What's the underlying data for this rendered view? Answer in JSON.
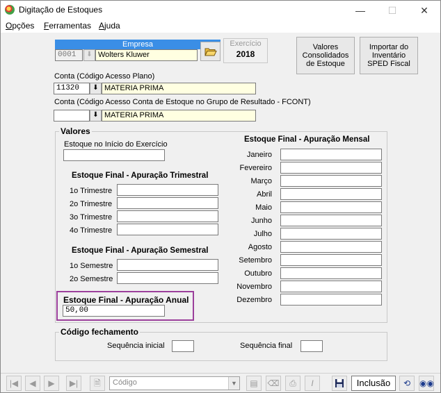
{
  "window": {
    "title": "Digitação de Estoques"
  },
  "menu": [
    {
      "hot": "O",
      "rest": "pções"
    },
    {
      "hot": "F",
      "rest": "erramentas"
    },
    {
      "hot": "A",
      "rest": "juda"
    }
  ],
  "empresa": {
    "header": "Empresa",
    "code": "0001",
    "name": "Wolters Kluwer"
  },
  "exercicio": {
    "label": "Exercício",
    "value": "2018"
  },
  "buttons": {
    "valores": [
      "Valores",
      "Consolidados",
      "de Estoque"
    ],
    "importar": [
      "Importar do",
      "Inventário",
      "SPED Fiscal"
    ]
  },
  "conta": {
    "label": "Conta (Código Acesso Plano)",
    "code": "11320",
    "desc": "MATERIA PRIMA"
  },
  "conta_fcont": {
    "label": "Conta (Código Acesso Conta de Estoque no Grupo de Resultado - FCONT)",
    "code": "",
    "desc": "MATERIA PRIMA"
  },
  "valores": {
    "legend": "Valores",
    "inicio_label": "Estoque no Início do Exercício",
    "inicio_value": "",
    "trimestral_title": "Estoque Final - Apuração Trimestral",
    "trimestres": [
      {
        "label": "1o Trimestre",
        "value": ""
      },
      {
        "label": "2o Trimestre",
        "value": ""
      },
      {
        "label": "3o Trimestre",
        "value": ""
      },
      {
        "label": "4o Trimestre",
        "value": ""
      }
    ],
    "semestral_title": "Estoque Final - Apuração Semestral",
    "semestres": [
      {
        "label": "1o Semestre",
        "value": ""
      },
      {
        "label": "2o Semestre",
        "value": ""
      }
    ],
    "anual_title": "Estoque Final - Apuração Anual",
    "anual_value": "50,00",
    "mensal_title": "Estoque Final - Apuração Mensal",
    "meses": [
      {
        "label": "Janeiro",
        "value": ""
      },
      {
        "label": "Fevereiro",
        "value": ""
      },
      {
        "label": "Março",
        "value": ""
      },
      {
        "label": "Abril",
        "value": ""
      },
      {
        "label": "Maio",
        "value": ""
      },
      {
        "label": "Junho",
        "value": ""
      },
      {
        "label": "Julho",
        "value": ""
      },
      {
        "label": "Agosto",
        "value": ""
      },
      {
        "label": "Setembro",
        "value": ""
      },
      {
        "label": "Outubro",
        "value": ""
      },
      {
        "label": "Novembro",
        "value": ""
      },
      {
        "label": "Dezembro",
        "value": ""
      }
    ]
  },
  "fechamento": {
    "legend": "Código fechamento",
    "seq_inicial_label": "Sequência inicial",
    "seq_inicial_value": "",
    "seq_final_label": "Sequência final",
    "seq_final_value": ""
  },
  "toolbar": {
    "combo_value": "Código",
    "status": "Inclusão"
  },
  "colors": {
    "accent": "#3a8ee6",
    "highlight_border": "#9b3f9b",
    "field_yellow": "#ffffe1"
  },
  "icons": [
    "app-icon",
    "minimize-icon",
    "maximize-icon",
    "close-icon",
    "open-folder-icon",
    "first-record-icon",
    "previous-record-icon",
    "next-record-icon",
    "last-record-icon",
    "new-document-icon",
    "save-disk-icon",
    "undo-icon",
    "binoculars-icon"
  ]
}
